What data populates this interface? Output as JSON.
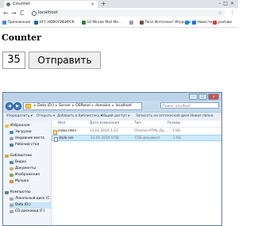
{
  "browser": {
    "tab_title": "Counter",
    "tab_close": "×",
    "new_tab": "+",
    "window_controls": "–□×",
    "back": "←",
    "forward": "→",
    "reload": "C",
    "url": "localhost",
    "star": "☆",
    "menu": "⋮",
    "bookmarks": [
      {
        "label": "Приложения",
        "color": "#4285f4"
      },
      {
        "label": "НГС.НОВОСИБИРСК",
        "color": "#1565c0"
      },
      {
        "label": "10 Minute Mail Mo...",
        "color": "#2e7d32"
      },
      {
        "label": "",
        "color": "#9e9e9e"
      },
      {
        "label": "Пазл Интеллект Игрушки",
        "color": "#6d4c41"
      },
      {
        "label": "",
        "color": "#1e88e5"
      },
      {
        "label": "Новости",
        "color": "#1a73e8"
      },
      {
        "label": "youtube",
        "color": "#e53935"
      }
    ]
  },
  "page": {
    "title": "Counter",
    "counter_value": "35",
    "submit_label": "Отправить"
  },
  "explorer": {
    "breadcrumbs": [
      "Data (D:)",
      "Server",
      "OSPanel",
      "domains",
      "localhost"
    ],
    "search_placeholder": "Поиск: localhost",
    "commands": [
      "Упорядочить ▾",
      "Открыть ▾",
      "Добавить в библиотеку ▾",
      "Общий доступ ▾",
      "Записать на оптический диск",
      "Новая папка"
    ],
    "nav_items": [
      {
        "label": "Избранное",
        "color": "#f2c230",
        "indent": 0
      },
      {
        "label": "Загрузки",
        "color": "#4a88d4",
        "indent": 6
      },
      {
        "label": "Недавние места",
        "color": "#8aa6c6",
        "indent": 6
      },
      {
        "label": "Рабочий стол",
        "color": "#4a7fbf",
        "indent": 6
      },
      {
        "label": "Библиотеки",
        "color": "#d9a441",
        "indent": 0
      },
      {
        "label": "Видео",
        "color": "#5a7fb0",
        "indent": 6
      },
      {
        "label": "Документы",
        "color": "#c9b27a",
        "indent": 6
      },
      {
        "label": "Изображения",
        "color": "#7ea65a",
        "indent": 6
      },
      {
        "label": "Музыка",
        "color": "#d58a3a",
        "indent": 6
      },
      {
        "label": "Компьютер",
        "color": "#5d7da1",
        "indent": 0
      },
      {
        "label": "Локальный диск (C",
        "color": "#9aa8b6",
        "indent": 6
      },
      {
        "label": "Data (D:)",
        "color": "#9aa8b6",
        "indent": 6
      },
      {
        "label": "CD-дисковод (F:)",
        "color": "#a9a9a9",
        "indent": 6
      }
    ],
    "columns": [
      "Имя",
      "Дата изменения",
      "Тип",
      "Размер"
    ],
    "files": [
      {
        "name": "index.html",
        "date": "13.01.2019 1:23",
        "type": "Chrome HTML Do...",
        "size": "1 КБ",
        "kind": "html"
      },
      {
        "name": "style.css",
        "date": "13.01.2019 0:58",
        "type": "CSS-документ",
        "size": "1 КБ",
        "kind": "css"
      }
    ]
  }
}
